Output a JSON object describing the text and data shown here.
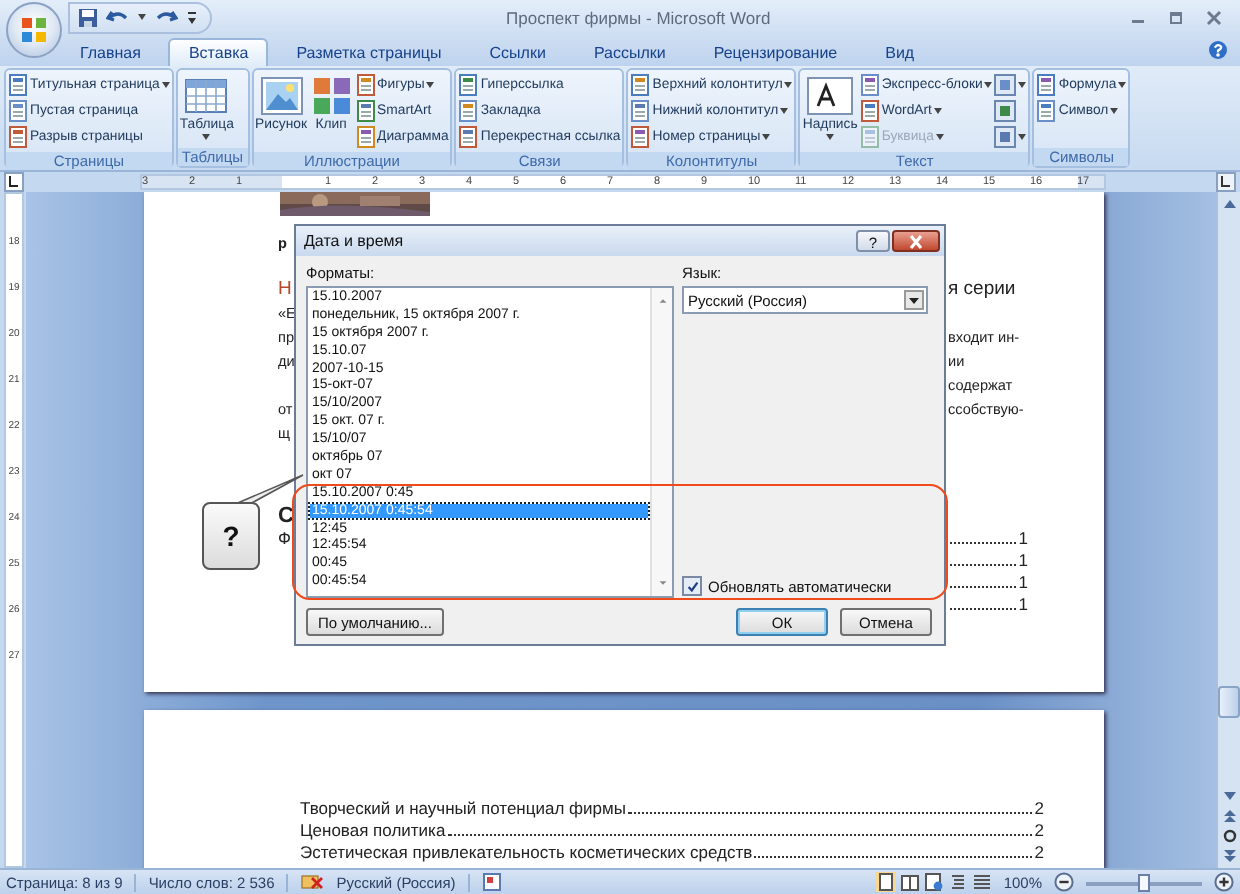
{
  "window": {
    "title": "Проспект фирмы - Microsoft Word"
  },
  "tabs": [
    {
      "label": "Главная",
      "selected": false
    },
    {
      "label": "Вставка",
      "selected": true
    },
    {
      "label": "Разметка страницы",
      "selected": false
    },
    {
      "label": "Ссылки",
      "selected": false
    },
    {
      "label": "Рассылки",
      "selected": false
    },
    {
      "label": "Рецензирование",
      "selected": false
    },
    {
      "label": "Вид",
      "selected": false
    }
  ],
  "ribbon_groups": [
    {
      "label": "Страницы",
      "items": [
        {
          "kind": "small",
          "label": "Титульная страница",
          "dropdown": true,
          "disabled": false
        },
        {
          "kind": "small",
          "label": "Пустая страница",
          "dropdown": false,
          "disabled": false
        },
        {
          "kind": "small",
          "label": "Разрыв страницы",
          "dropdown": false,
          "disabled": false
        }
      ]
    },
    {
      "label": "Таблицы",
      "items": [
        {
          "kind": "large",
          "label": "Таблица",
          "dropdown": true,
          "disabled": false
        }
      ]
    },
    {
      "label": "Иллюстрации",
      "items": [
        {
          "kind": "large",
          "label": "Рисунок",
          "dropdown": false,
          "disabled": false
        },
        {
          "kind": "large",
          "label": "Клип",
          "dropdown": false,
          "disabled": false
        },
        {
          "kind": "small",
          "label": "Фигуры",
          "dropdown": true,
          "disabled": false
        },
        {
          "kind": "small",
          "label": "SmartArt",
          "dropdown": false,
          "disabled": false
        },
        {
          "kind": "small",
          "label": "Диаграмма",
          "dropdown": false,
          "disabled": false
        }
      ]
    },
    {
      "label": "Связи",
      "items": [
        {
          "kind": "small",
          "label": "Гиперссылка",
          "dropdown": false,
          "disabled": false
        },
        {
          "kind": "small",
          "label": "Закладка",
          "dropdown": false,
          "disabled": false
        },
        {
          "kind": "small",
          "label": "Перекрестная ссылка",
          "dropdown": false,
          "disabled": false
        }
      ]
    },
    {
      "label": "Колонтитулы",
      "items": [
        {
          "kind": "small",
          "label": "Верхний колонтитул",
          "dropdown": true,
          "disabled": false
        },
        {
          "kind": "small",
          "label": "Нижний колонтитул",
          "dropdown": true,
          "disabled": false
        },
        {
          "kind": "small",
          "label": "Номер страницы",
          "dropdown": true,
          "disabled": false
        }
      ]
    },
    {
      "label": "Текст",
      "items": [
        {
          "kind": "large",
          "label": "Надпись",
          "dropdown": true,
          "disabled": false
        },
        {
          "kind": "small",
          "label": "Экспресс-блоки",
          "dropdown": true,
          "disabled": false
        },
        {
          "kind": "small",
          "label": "WordArt",
          "dropdown": true,
          "disabled": false
        },
        {
          "kind": "small",
          "label": "Буквица",
          "dropdown": true,
          "disabled": true
        },
        {
          "kind": "icon",
          "dropdown": true,
          "disabled": false
        },
        {
          "kind": "icon",
          "dropdown": false,
          "disabled": false
        },
        {
          "kind": "icon",
          "dropdown": true,
          "disabled": false
        }
      ]
    },
    {
      "label": "Символы",
      "items": [
        {
          "kind": "small",
          "label": "Формула",
          "dropdown": true,
          "disabled": false
        },
        {
          "kind": "small",
          "label": "Символ",
          "dropdown": true,
          "disabled": false
        }
      ]
    }
  ],
  "ruler": {
    "labels": [
      "3",
      "2",
      "1",
      "1",
      "2",
      "3",
      "4",
      "5",
      "6",
      "7",
      "8",
      "9",
      "10",
      "11",
      "12",
      "13",
      "14",
      "15",
      "16",
      "17"
    ]
  },
  "vertical_ruler": {
    "labels": [
      "18",
      "19",
      "20",
      "21",
      "22",
      "23",
      "24",
      "25",
      "26",
      "27"
    ]
  },
  "document": {
    "page1_rows": [
      {
        "kind": "title",
        "left": "р"
      },
      {
        "kind": "lead",
        "left": "Н",
        "right": "я серии"
      },
      {
        "kind": "body",
        "left": "«Е"
      },
      {
        "kind": "body",
        "left": "пр",
        "right": "входит ин-"
      },
      {
        "kind": "body",
        "left": "ди",
        "right": "ии содержат"
      },
      {
        "kind": "body",
        "left": "от",
        "right": "ссобствую-"
      },
      {
        "kind": "body",
        "left": "щ"
      },
      {
        "kind": "heading",
        "left": "С"
      },
      {
        "kind": "toc",
        "left": "Ф",
        "page": "1"
      },
      {
        "kind": "toc",
        "page": "1"
      },
      {
        "kind": "toc",
        "page": "1"
      },
      {
        "kind": "toc",
        "page": "1"
      }
    ],
    "page2_toc": [
      {
        "title": "Творческий и научный потенциал фирмы",
        "page": "2"
      },
      {
        "title": "Ценовая политика",
        "page": "2"
      },
      {
        "title": "Эстетическая привлекательность косметических средств",
        "page": "2"
      }
    ]
  },
  "dialog": {
    "title": "Дата и время",
    "help_button": "?",
    "formats_label": "Форматы:",
    "formats": [
      {
        "text": "15.10.2007",
        "selected": false
      },
      {
        "text": "понедельник, 15 октября 2007 г.",
        "selected": false
      },
      {
        "text": "15 октября 2007 г.",
        "selected": false
      },
      {
        "text": "15.10.07",
        "selected": false
      },
      {
        "text": "2007-10-15",
        "selected": false
      },
      {
        "text": "15-окт-07",
        "selected": false
      },
      {
        "text": "15/10/2007",
        "selected": false
      },
      {
        "text": "15 окт. 07 г.",
        "selected": false
      },
      {
        "text": "15/10/07",
        "selected": false
      },
      {
        "text": "октябрь 07",
        "selected": false
      },
      {
        "text": "окт 07",
        "selected": false
      },
      {
        "text": "15.10.2007 0:45",
        "selected": false
      },
      {
        "text": "15.10.2007 0:45:54",
        "selected": true
      },
      {
        "text": "12:45",
        "selected": false
      },
      {
        "text": "12:45:54",
        "selected": false
      },
      {
        "text": "00:45",
        "selected": false
      },
      {
        "text": "00:45:54",
        "selected": false
      }
    ],
    "language_label": "Язык:",
    "language": "Русский (Россия)",
    "auto_update": {
      "label": "Обновлять автоматически",
      "checked": true
    },
    "buttons": [
      {
        "label": "По умолчанию...",
        "default": false
      },
      {
        "label": "ОК",
        "default": true
      },
      {
        "label": "Отмена",
        "default": false
      }
    ]
  },
  "callout": {
    "text": "?"
  },
  "status_bar": {
    "page": "Страница: 8 из 9",
    "words": "Число слов: 2 536",
    "language": "Русский (Россия)",
    "zoom": "100%",
    "zoom_level": {
      "level": 0.5
    }
  }
}
